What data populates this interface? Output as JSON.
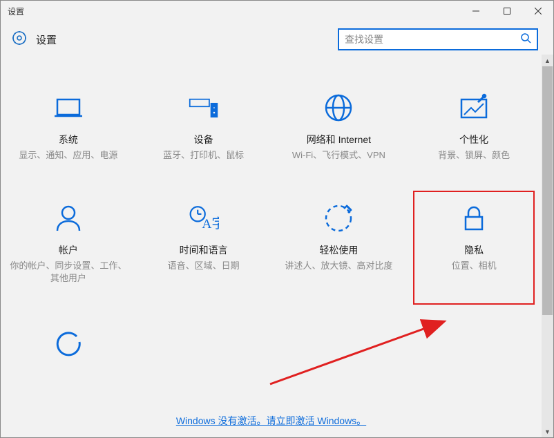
{
  "window": {
    "title": "设置"
  },
  "header": {
    "title": "设置"
  },
  "search": {
    "placeholder": "查找设置"
  },
  "tiles": [
    {
      "title": "系统",
      "sub": "显示、通知、应用、电源"
    },
    {
      "title": "设备",
      "sub": "蓝牙、打印机、鼠标"
    },
    {
      "title": "网络和 Internet",
      "sub": "Wi-Fi、飞行模式、VPN"
    },
    {
      "title": "个性化",
      "sub": "背景、锁屏、颜色"
    },
    {
      "title": "帐户",
      "sub": "你的帐户、同步设置、工作、其他用户"
    },
    {
      "title": "时间和语言",
      "sub": "语音、区域、日期"
    },
    {
      "title": "轻松使用",
      "sub": "讲述人、放大镜、高对比度"
    },
    {
      "title": "隐私",
      "sub": "位置、相机"
    }
  ],
  "activation_link": "Windows 没有激活。请立即激活 Windows。"
}
